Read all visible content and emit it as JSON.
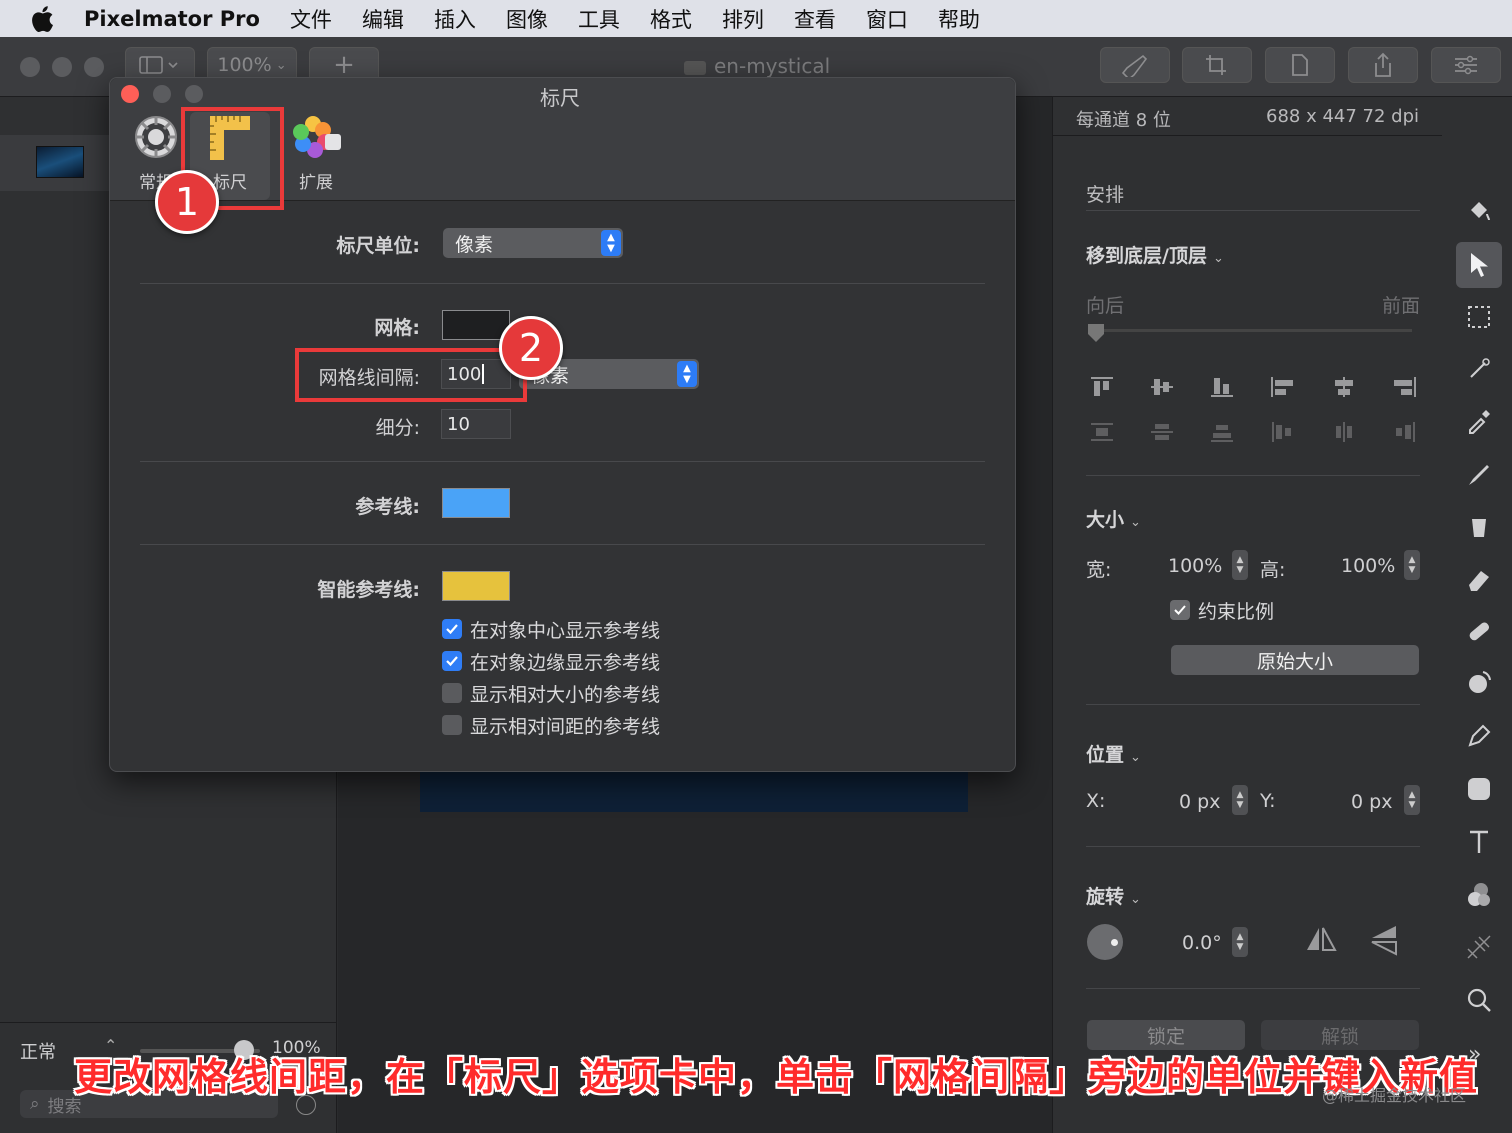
{
  "menubar": {
    "app_name": "Pixelmator Pro",
    "items": [
      "文件",
      "编辑",
      "插入",
      "图像",
      "工具",
      "格式",
      "排列",
      "查看",
      "窗口",
      "帮助"
    ]
  },
  "window": {
    "doc_title": "en-mystical",
    "zoom": "100%"
  },
  "dialog": {
    "title": "标尺",
    "tabs": [
      {
        "label": "常规",
        "icon": "gear-icon"
      },
      {
        "label": "标尺",
        "icon": "ruler-icon"
      },
      {
        "label": "扩展",
        "icon": "photos-extension-icon"
      }
    ],
    "ruler_units_label": "标尺单位:",
    "ruler_units_value": "像素",
    "grid_label": "网格:",
    "grid_color": "#1e1f21",
    "grid_spacing_label": "网格线间隔:",
    "grid_spacing_value": "100",
    "grid_spacing_unit": "像素",
    "subdivisions_label": "细分:",
    "subdivisions_value": "10",
    "guides_label": "参考线:",
    "guides_color": "#4aa3f7",
    "smart_guides_label": "智能参考线:",
    "smart_guides_color": "#e6c23d",
    "checkboxes": [
      {
        "label": "在对象中心显示参考线",
        "checked": true
      },
      {
        "label": "在对象边缘显示参考线",
        "checked": true
      },
      {
        "label": "显示相对大小的参考线",
        "checked": false
      },
      {
        "label": "显示相对间距的参考线",
        "checked": false
      }
    ]
  },
  "inspector": {
    "bit_depth": "每通道 8 位",
    "dimensions": "688 x 447 72 dpi",
    "arrange_title": "安排",
    "move_menu": "移到底层/顶层",
    "back_label": "向后",
    "front_label": "前面",
    "size_title": "大小",
    "width_label": "宽:",
    "width_value": "100%",
    "height_label": "高:",
    "height_value": "100%",
    "constrain_label": "约束比例",
    "original_size_button": "原始大小",
    "position_title": "位置",
    "x_label": "X:",
    "x_value": "0 px",
    "y_label": "Y:",
    "y_value": "0 px",
    "rotate_title": "旋转",
    "rotate_value": "0.0°",
    "lock_button": "锁定",
    "unlock_button": "解锁"
  },
  "sidebar": {
    "blend_mode": "正常",
    "opacity": "100%",
    "search_placeholder": "搜索"
  },
  "annotations": {
    "badge_1": "1",
    "badge_2": "2",
    "caption": "更改网格线间距，在「标尺」选项卡中，单击「网格间隔」旁边的单位并键入新值",
    "watermark": "@稀土掘金技术社区"
  }
}
